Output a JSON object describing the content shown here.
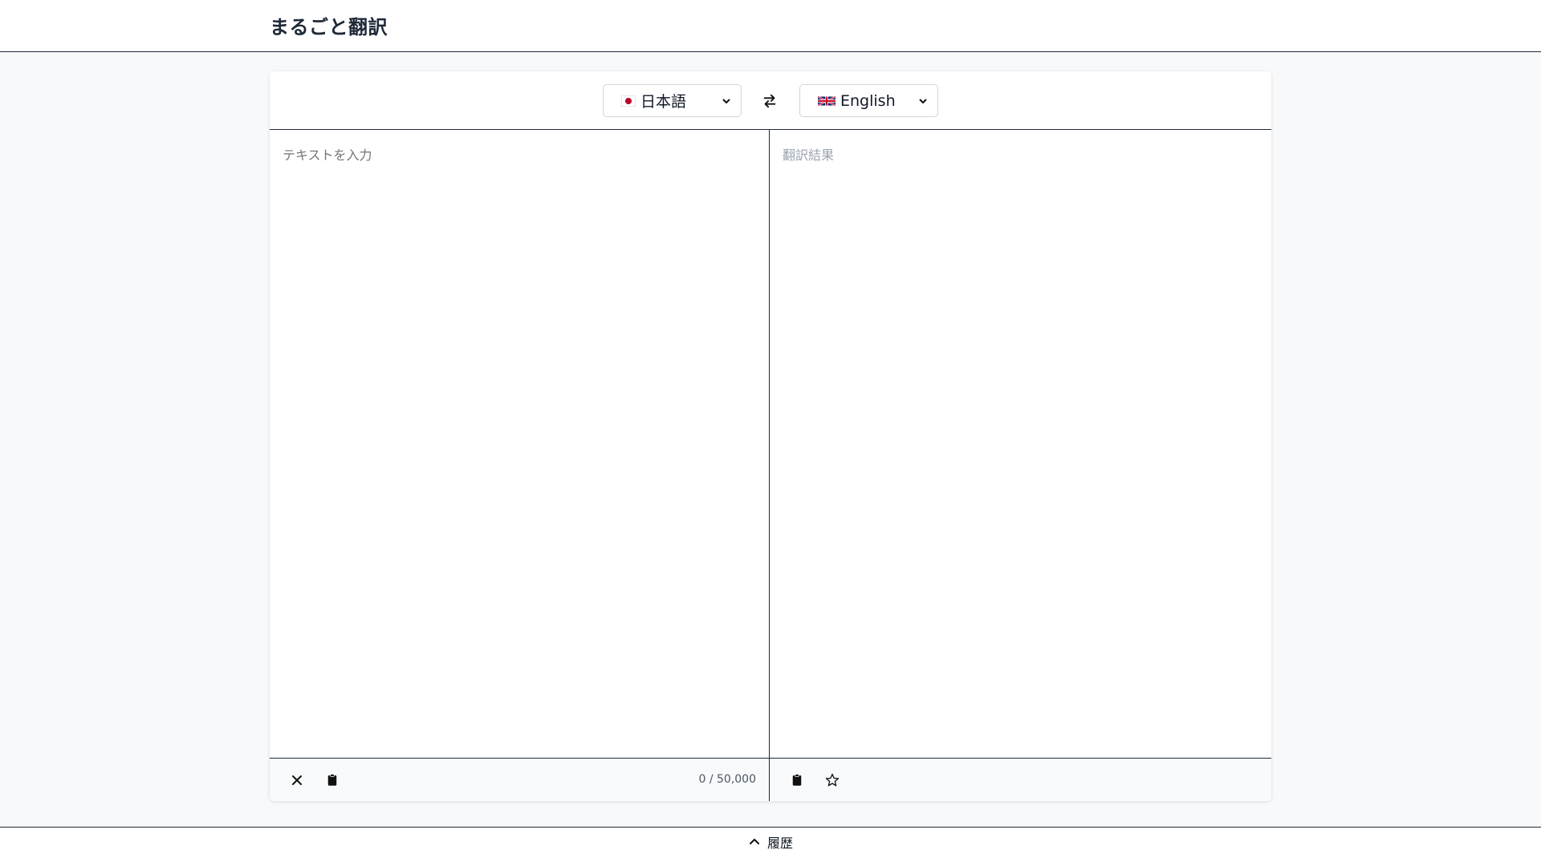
{
  "header": {
    "title": "まるごと翻訳"
  },
  "languages": {
    "source": {
      "label": "日本語",
      "flag": "japan-flag-icon"
    },
    "target": {
      "label": "English",
      "flag": "uk-flag-icon"
    }
  },
  "source_pane": {
    "placeholder": "テキストを入力",
    "char_count": "0 / 50,000"
  },
  "target_pane": {
    "placeholder": "翻訳結果"
  },
  "history": {
    "label": "履歴"
  },
  "colors": {
    "accent": "#1f2937",
    "background": "#f8f9fa",
    "japan_red": "#bc002d"
  }
}
